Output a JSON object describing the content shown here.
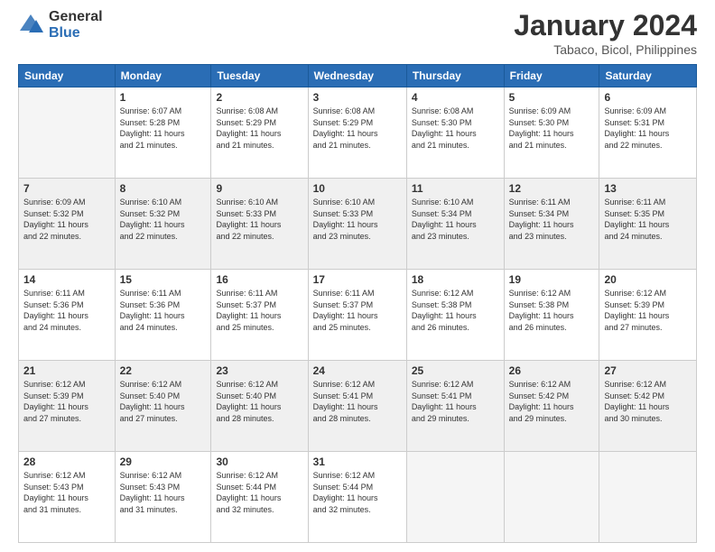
{
  "header": {
    "logo_general": "General",
    "logo_blue": "Blue",
    "month_title": "January 2024",
    "location": "Tabaco, Bicol, Philippines"
  },
  "days_of_week": [
    "Sunday",
    "Monday",
    "Tuesday",
    "Wednesday",
    "Thursday",
    "Friday",
    "Saturday"
  ],
  "weeks": [
    [
      {
        "num": "",
        "sunrise": "",
        "sunset": "",
        "daylight": "",
        "empty": true
      },
      {
        "num": "1",
        "sunrise": "Sunrise: 6:07 AM",
        "sunset": "Sunset: 5:28 PM",
        "daylight": "Daylight: 11 hours and 21 minutes."
      },
      {
        "num": "2",
        "sunrise": "Sunrise: 6:08 AM",
        "sunset": "Sunset: 5:29 PM",
        "daylight": "Daylight: 11 hours and 21 minutes."
      },
      {
        "num": "3",
        "sunrise": "Sunrise: 6:08 AM",
        "sunset": "Sunset: 5:29 PM",
        "daylight": "Daylight: 11 hours and 21 minutes."
      },
      {
        "num": "4",
        "sunrise": "Sunrise: 6:08 AM",
        "sunset": "Sunset: 5:30 PM",
        "daylight": "Daylight: 11 hours and 21 minutes."
      },
      {
        "num": "5",
        "sunrise": "Sunrise: 6:09 AM",
        "sunset": "Sunset: 5:30 PM",
        "daylight": "Daylight: 11 hours and 21 minutes."
      },
      {
        "num": "6",
        "sunrise": "Sunrise: 6:09 AM",
        "sunset": "Sunset: 5:31 PM",
        "daylight": "Daylight: 11 hours and 22 minutes."
      }
    ],
    [
      {
        "num": "7",
        "sunrise": "Sunrise: 6:09 AM",
        "sunset": "Sunset: 5:32 PM",
        "daylight": "Daylight: 11 hours and 22 minutes."
      },
      {
        "num": "8",
        "sunrise": "Sunrise: 6:10 AM",
        "sunset": "Sunset: 5:32 PM",
        "daylight": "Daylight: 11 hours and 22 minutes."
      },
      {
        "num": "9",
        "sunrise": "Sunrise: 6:10 AM",
        "sunset": "Sunset: 5:33 PM",
        "daylight": "Daylight: 11 hours and 22 minutes."
      },
      {
        "num": "10",
        "sunrise": "Sunrise: 6:10 AM",
        "sunset": "Sunset: 5:33 PM",
        "daylight": "Daylight: 11 hours and 23 minutes."
      },
      {
        "num": "11",
        "sunrise": "Sunrise: 6:10 AM",
        "sunset": "Sunset: 5:34 PM",
        "daylight": "Daylight: 11 hours and 23 minutes."
      },
      {
        "num": "12",
        "sunrise": "Sunrise: 6:11 AM",
        "sunset": "Sunset: 5:34 PM",
        "daylight": "Daylight: 11 hours and 23 minutes."
      },
      {
        "num": "13",
        "sunrise": "Sunrise: 6:11 AM",
        "sunset": "Sunset: 5:35 PM",
        "daylight": "Daylight: 11 hours and 24 minutes."
      }
    ],
    [
      {
        "num": "14",
        "sunrise": "Sunrise: 6:11 AM",
        "sunset": "Sunset: 5:36 PM",
        "daylight": "Daylight: 11 hours and 24 minutes."
      },
      {
        "num": "15",
        "sunrise": "Sunrise: 6:11 AM",
        "sunset": "Sunset: 5:36 PM",
        "daylight": "Daylight: 11 hours and 24 minutes."
      },
      {
        "num": "16",
        "sunrise": "Sunrise: 6:11 AM",
        "sunset": "Sunset: 5:37 PM",
        "daylight": "Daylight: 11 hours and 25 minutes."
      },
      {
        "num": "17",
        "sunrise": "Sunrise: 6:11 AM",
        "sunset": "Sunset: 5:37 PM",
        "daylight": "Daylight: 11 hours and 25 minutes."
      },
      {
        "num": "18",
        "sunrise": "Sunrise: 6:12 AM",
        "sunset": "Sunset: 5:38 PM",
        "daylight": "Daylight: 11 hours and 26 minutes."
      },
      {
        "num": "19",
        "sunrise": "Sunrise: 6:12 AM",
        "sunset": "Sunset: 5:38 PM",
        "daylight": "Daylight: 11 hours and 26 minutes."
      },
      {
        "num": "20",
        "sunrise": "Sunrise: 6:12 AM",
        "sunset": "Sunset: 5:39 PM",
        "daylight": "Daylight: 11 hours and 27 minutes."
      }
    ],
    [
      {
        "num": "21",
        "sunrise": "Sunrise: 6:12 AM",
        "sunset": "Sunset: 5:39 PM",
        "daylight": "Daylight: 11 hours and 27 minutes."
      },
      {
        "num": "22",
        "sunrise": "Sunrise: 6:12 AM",
        "sunset": "Sunset: 5:40 PM",
        "daylight": "Daylight: 11 hours and 27 minutes."
      },
      {
        "num": "23",
        "sunrise": "Sunrise: 6:12 AM",
        "sunset": "Sunset: 5:40 PM",
        "daylight": "Daylight: 11 hours and 28 minutes."
      },
      {
        "num": "24",
        "sunrise": "Sunrise: 6:12 AM",
        "sunset": "Sunset: 5:41 PM",
        "daylight": "Daylight: 11 hours and 28 minutes."
      },
      {
        "num": "25",
        "sunrise": "Sunrise: 6:12 AM",
        "sunset": "Sunset: 5:41 PM",
        "daylight": "Daylight: 11 hours and 29 minutes."
      },
      {
        "num": "26",
        "sunrise": "Sunrise: 6:12 AM",
        "sunset": "Sunset: 5:42 PM",
        "daylight": "Daylight: 11 hours and 29 minutes."
      },
      {
        "num": "27",
        "sunrise": "Sunrise: 6:12 AM",
        "sunset": "Sunset: 5:42 PM",
        "daylight": "Daylight: 11 hours and 30 minutes."
      }
    ],
    [
      {
        "num": "28",
        "sunrise": "Sunrise: 6:12 AM",
        "sunset": "Sunset: 5:43 PM",
        "daylight": "Daylight: 11 hours and 31 minutes."
      },
      {
        "num": "29",
        "sunrise": "Sunrise: 6:12 AM",
        "sunset": "Sunset: 5:43 PM",
        "daylight": "Daylight: 11 hours and 31 minutes."
      },
      {
        "num": "30",
        "sunrise": "Sunrise: 6:12 AM",
        "sunset": "Sunset: 5:44 PM",
        "daylight": "Daylight: 11 hours and 32 minutes."
      },
      {
        "num": "31",
        "sunrise": "Sunrise: 6:12 AM",
        "sunset": "Sunset: 5:44 PM",
        "daylight": "Daylight: 11 hours and 32 minutes."
      },
      {
        "num": "",
        "sunrise": "",
        "sunset": "",
        "daylight": "",
        "empty": true
      },
      {
        "num": "",
        "sunrise": "",
        "sunset": "",
        "daylight": "",
        "empty": true
      },
      {
        "num": "",
        "sunrise": "",
        "sunset": "",
        "daylight": "",
        "empty": true
      }
    ]
  ]
}
